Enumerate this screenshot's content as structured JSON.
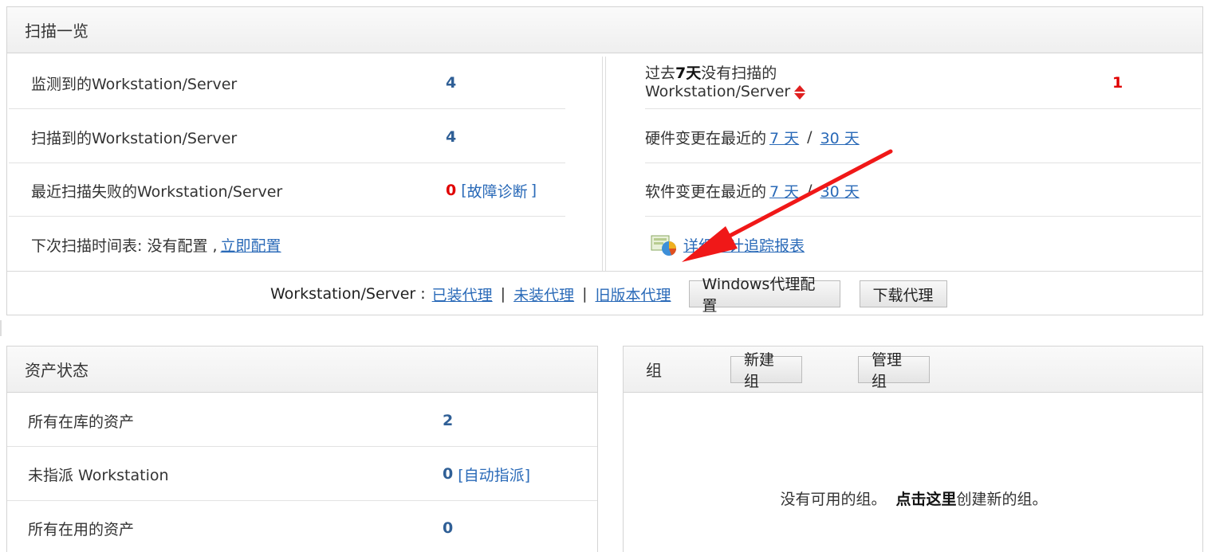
{
  "scan": {
    "title": "扫描一览",
    "detected_label": "监测到的Workstation/Server",
    "detected_value": "4",
    "scanned_label": "扫描到的Workstation/Server",
    "scanned_value": "4",
    "failed_label": "最近扫描失败的Workstation/Server",
    "failed_value": "0",
    "diagnose_open": "[",
    "diagnose_link": "故障诊断",
    "diagnose_close": "]",
    "schedule_label": "下次扫描时间表: 没有配置 ,",
    "schedule_link": "立即配置",
    "not_scanned_prefix": "过去",
    "not_scanned_days": "7天",
    "not_scanned_suffix": "没有扫描的",
    "not_scanned_line2": "Workstation/Server",
    "not_scanned_value": "1",
    "hw_label": "硬件变更在最近的",
    "hw_7": "7 天",
    "hw_slash": "/",
    "hw_30": "30 天",
    "sw_label": "软件变更在最近的",
    "sw_7": "7 天",
    "sw_slash": "/",
    "sw_30": "30 天",
    "audit_link": "详细审计追踪报表",
    "agent_label": "Workstation/Server :",
    "installed_agent": "已装代理",
    "not_installed_agent": "未装代理",
    "old_agent": "旧版本代理",
    "pipe": "|",
    "windows_agent_btn": "Windows代理配置",
    "download_agent_btn": "下载代理"
  },
  "asset": {
    "title": "资产状态",
    "all_in_stock_label": "所有在库的资产",
    "all_in_stock_value": "2",
    "unassigned_label": "未指派 Workstation",
    "unassigned_value": "0",
    "auto_assign": "[自动指派]",
    "in_use_label": "所有在用的资产",
    "in_use_value": "0"
  },
  "group": {
    "title": "组",
    "new_group_btn": "新建组",
    "manage_group_btn": "管理组",
    "empty_text": "没有可用的组。",
    "click_here": "点击这里",
    "create_text": "创建新的组。"
  },
  "colors": {
    "link": "#2a6ab8",
    "number": "#2f5f96",
    "alert": "#e00000",
    "arrow": "#f01818"
  }
}
